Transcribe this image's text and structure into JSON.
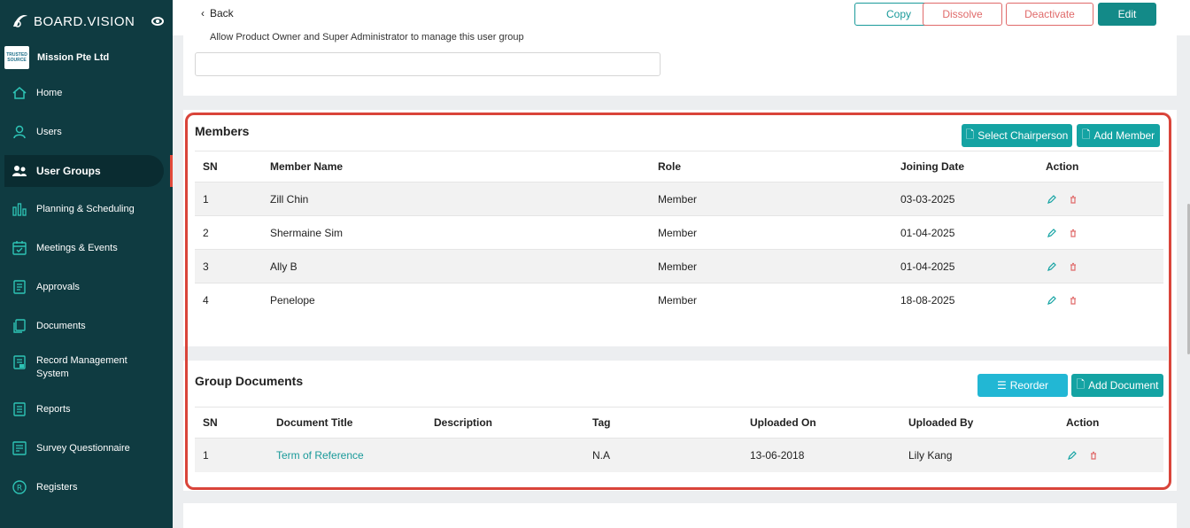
{
  "app": {
    "brand": "BOARD.VISION",
    "org_name": "Mission Pte Ltd",
    "org_logo_text": "TRUSTED SOURCE"
  },
  "sidebar": {
    "items": [
      {
        "label": "Home",
        "icon": "home-icon"
      },
      {
        "label": "Users",
        "icon": "user-icon"
      },
      {
        "label": "User Groups",
        "icon": "users-icon",
        "active": true
      },
      {
        "label": "Planning & Scheduling",
        "icon": "chart-bars-icon"
      },
      {
        "label": "Meetings & Events",
        "icon": "calendar-icon"
      },
      {
        "label": "Approvals",
        "icon": "document-check-icon"
      },
      {
        "label": "Documents",
        "icon": "documents-icon"
      },
      {
        "label": "Record Management System",
        "icon": "records-icon"
      },
      {
        "label": "Reports",
        "icon": "report-icon"
      },
      {
        "label": "Survey Questionnaire",
        "icon": "survey-icon"
      },
      {
        "label": "Registers",
        "icon": "registered-icon"
      }
    ]
  },
  "toolbar": {
    "back_label": "Back",
    "copy_label": "Copy",
    "dissolve_label": "Dissolve",
    "deactivate_label": "Deactivate",
    "edit_label": "Edit"
  },
  "settings": {
    "allow_text": "Allow Product Owner and Super Administrator to manage this user group",
    "input_value": ""
  },
  "members": {
    "title": "Members",
    "select_chair_label": "Select Chairperson",
    "add_member_label": "Add Member",
    "columns": [
      "SN",
      "Member Name",
      "Role",
      "Joining Date",
      "Action"
    ],
    "rows": [
      {
        "sn": "1",
        "name": "Zill Chin",
        "role": "Member",
        "date": "03-03-2025"
      },
      {
        "sn": "2",
        "name": "Shermaine Sim",
        "role": "Member",
        "date": "01-04-2025"
      },
      {
        "sn": "3",
        "name": "Ally B",
        "role": "Member",
        "date": "01-04-2025"
      },
      {
        "sn": "4",
        "name": "Penelope",
        "role": "Member",
        "date": "18-08-2025"
      }
    ]
  },
  "documents": {
    "title": "Group Documents",
    "reorder_label": "Reorder",
    "add_document_label": "Add Document",
    "columns": [
      "SN",
      "Document Title",
      "Description",
      "Tag",
      "Uploaded On",
      "Uploaded By",
      "Action"
    ],
    "rows": [
      {
        "sn": "1",
        "title": "Term of Reference",
        "description": "",
        "tag": "N.A",
        "uploaded_on": "13-06-2018",
        "uploaded_by": "Lily Kang"
      }
    ]
  },
  "colors": {
    "sidebar": "#0f3b41",
    "accent": "#14a3a3",
    "danger": "#e06a6a",
    "highlight": "#d9443a"
  }
}
